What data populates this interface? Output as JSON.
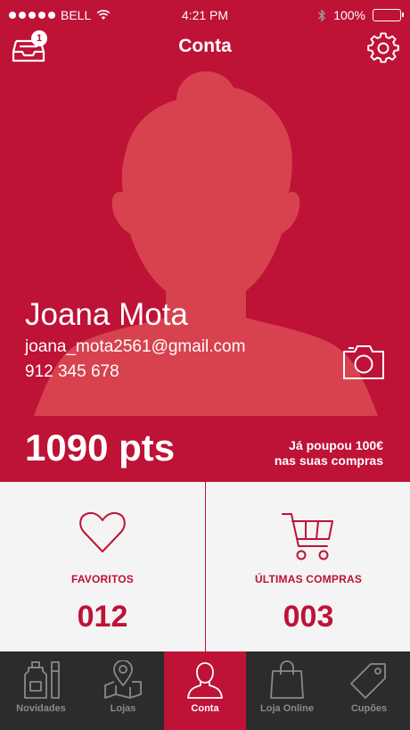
{
  "statusbar": {
    "carrier": "BELL",
    "time": "4:21 PM",
    "battery": "100%"
  },
  "navbar": {
    "title": "Conta",
    "inbox_badge": "1"
  },
  "profile": {
    "name": "Joana Mota",
    "email": "joana_mota2561@gmail.com",
    "phone": "912 345 678",
    "points": "1090 pts",
    "savings_prefix": "Já poupou ",
    "savings_amount": "100€",
    "savings_suffix": "nas suas compras"
  },
  "stats": [
    {
      "label": "FAVORITOS",
      "value": "012",
      "icon": "heart-icon"
    },
    {
      "label": "ÚLTIMAS COMPRAS",
      "value": "003",
      "icon": "cart-icon"
    }
  ],
  "tabs": [
    {
      "label": "Novidades",
      "icon": "perfume-bottles-icon"
    },
    {
      "label": "Lojas",
      "icon": "map-pin-icon"
    },
    {
      "label": "Conta",
      "icon": "user-icon"
    },
    {
      "label": "Loja Online",
      "icon": "shopping-bag-icon"
    },
    {
      "label": "Cupões",
      "icon": "tag-icon"
    }
  ],
  "colors": {
    "accent": "#BE1237",
    "tabbar": "#2C2C2C",
    "stats_bg": "#F4F4F4",
    "inactive_tab": "#8A8A8A"
  }
}
